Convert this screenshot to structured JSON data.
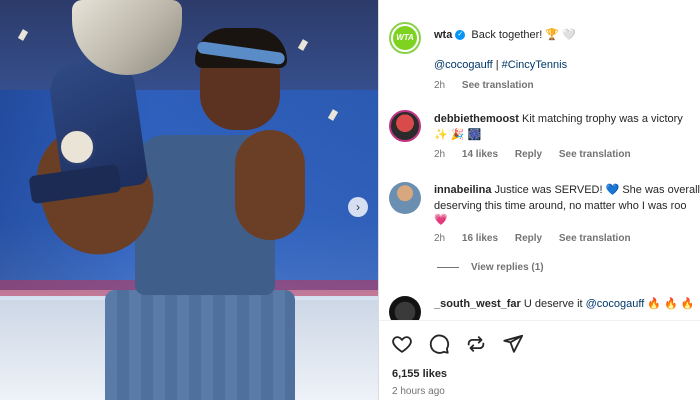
{
  "post": {
    "author": "wta",
    "caption": "Back together!",
    "caption_emoji": "🏆 🤍",
    "tags": [
      "@cocogauff",
      "#CincyTennis"
    ],
    "tag_separator": "|",
    "time": "2h",
    "see_translation": "See translation"
  },
  "comments": [
    {
      "user": "debbiethemoost",
      "text": "Kit matching trophy was a victory",
      "text_line2": "✨ 🎉 🎆",
      "time": "2h",
      "likes": "14 likes",
      "reply": "Reply",
      "see_translation": "See translation"
    },
    {
      "user": "innabeilina",
      "text": "Justice was SERVED! 💙 She was overall",
      "text_line2": "deserving this time around, no matter who I was roo",
      "text_line3": "💗",
      "time": "2h",
      "likes": "16 likes",
      "reply": "Reply",
      "see_translation": "See translation",
      "view_replies": "View replies (1)"
    },
    {
      "user": "_south_west_far",
      "text": "U deserve it",
      "mention": "@cocogauff",
      "emoji": "🔥 🔥 🔥"
    }
  ],
  "footer": {
    "likes": "6,155 likes",
    "time": "2 hours ago"
  },
  "colors": {
    "link": "#00376b",
    "verified": "#0095f6",
    "meta": "#737373"
  }
}
